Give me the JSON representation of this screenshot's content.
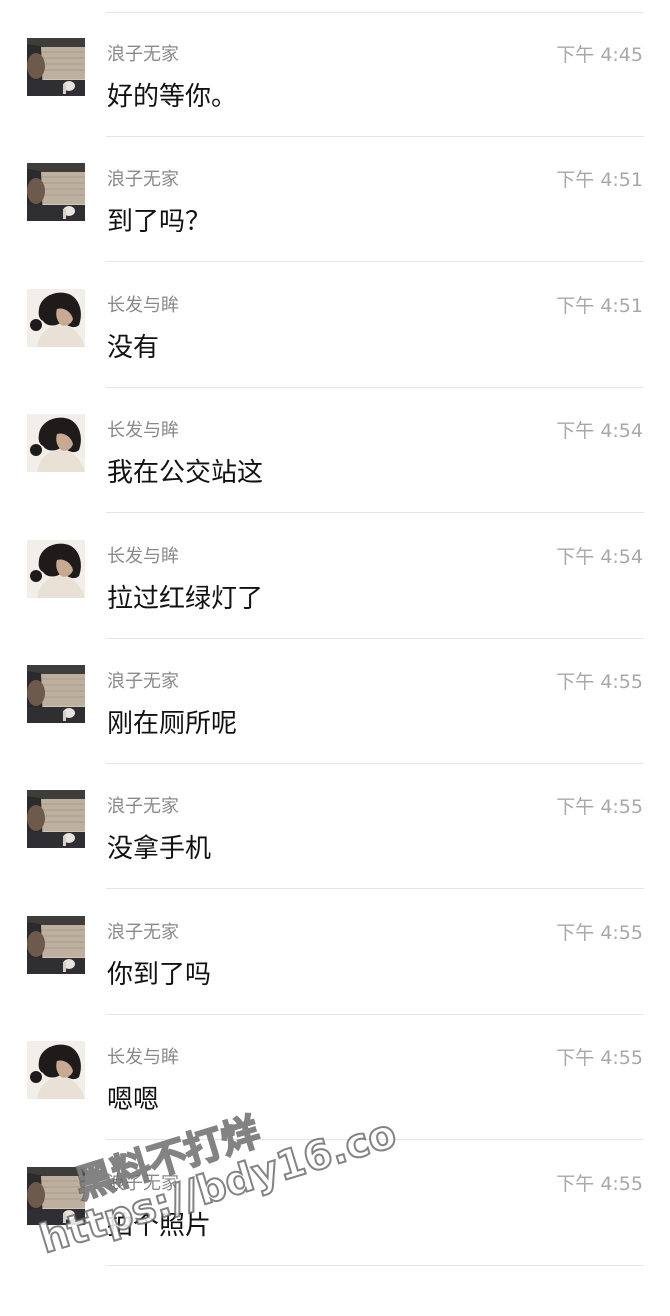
{
  "colors": {
    "background": "#ffffff",
    "name": "#8a8a8a",
    "time": "#a8a8a8",
    "text": "#111111",
    "divider": "#e5e5e5"
  },
  "messages": [
    {
      "sender": "浪子无家",
      "time": "下午 4:45",
      "text": "好的等你。",
      "avatar": "man-in-car-avatar"
    },
    {
      "sender": "浪子无家",
      "time": "下午 4:51",
      "text": "到了吗？",
      "avatar": "man-in-car-avatar"
    },
    {
      "sender": "长发与眸",
      "time": "下午 4:51",
      "text": "没有",
      "avatar": "woman-dark-hair-avatar"
    },
    {
      "sender": "长发与眸",
      "time": "下午 4:54",
      "text": "我在公交站这",
      "avatar": "woman-dark-hair-avatar"
    },
    {
      "sender": "长发与眸",
      "time": "下午 4:54",
      "text": "拉过红绿灯了",
      "avatar": "woman-dark-hair-avatar"
    },
    {
      "sender": "浪子无家",
      "time": "下午 4:55",
      "text": "刚在厕所呢",
      "avatar": "man-in-car-avatar"
    },
    {
      "sender": "浪子无家",
      "time": "下午 4:55",
      "text": "没拿手机",
      "avatar": "man-in-car-avatar"
    },
    {
      "sender": "浪子无家",
      "time": "下午 4:55",
      "text": "你到了吗",
      "avatar": "man-in-car-avatar"
    },
    {
      "sender": "长发与眸",
      "time": "下午 4:55",
      "text": "嗯嗯",
      "avatar": "woman-dark-hair-avatar"
    },
    {
      "sender": "浪子无家",
      "time": "下午 4:55",
      "text": "拍个照片",
      "avatar": "man-in-car-avatar"
    }
  ],
  "watermark": {
    "line1": "黑料不打烊",
    "line2": "https://bdy16.co"
  }
}
